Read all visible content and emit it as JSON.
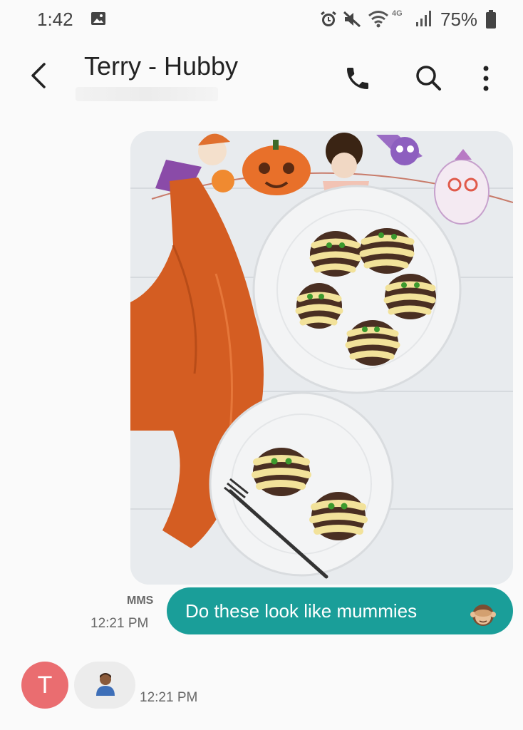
{
  "status_bar": {
    "time": "1:42",
    "network": "4G",
    "battery": "75%",
    "icons": [
      "gallery-icon",
      "alarm-icon",
      "mute-icon",
      "wifi-icon",
      "signal-icon",
      "battery-icon"
    ]
  },
  "header": {
    "contact_name": "Terry - Hubby",
    "icons": [
      "back-arrow-icon",
      "phone-icon",
      "search-icon",
      "more-vertical-icon"
    ]
  },
  "conversation": {
    "outgoing": {
      "type_label": "MMS",
      "time": "12:21 PM",
      "text": "Do these look like mummies",
      "emoji": "see-no-evil-monkey-emoji"
    },
    "incoming": {
      "avatar_letter": "T",
      "emoji": "person-emoji",
      "time": "12:21 PM"
    }
  },
  "colors": {
    "accent": "#1a9e99",
    "avatar": "#ea6d70",
    "incoming_bubble": "#ececec",
    "background": "#fafafa"
  }
}
